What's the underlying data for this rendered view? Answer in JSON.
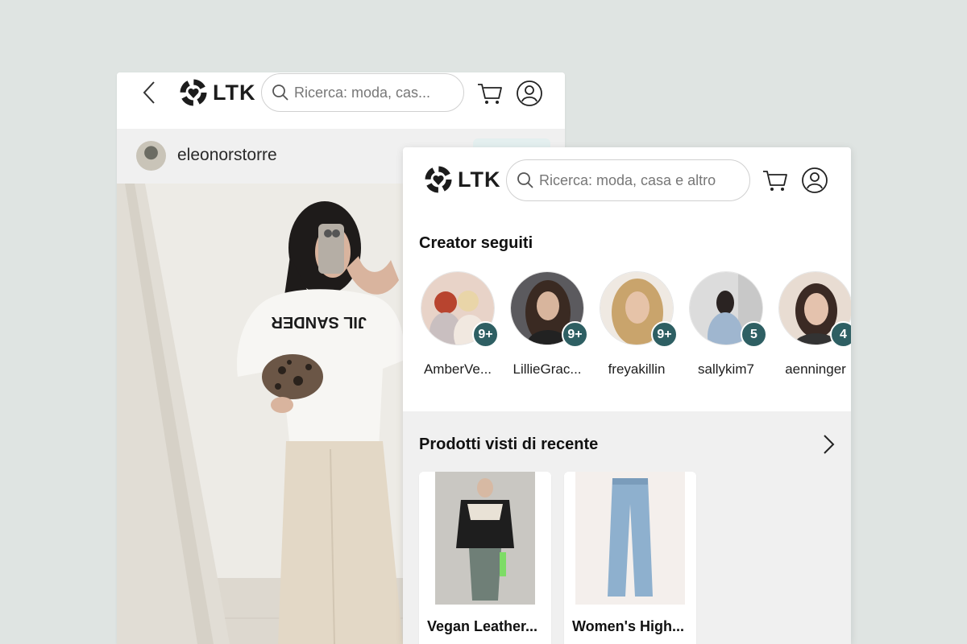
{
  "back_window": {
    "search_placeholder": "Ricerca: moda, cas...",
    "profile_name": "eleonorstorre",
    "logo_text": "LTK"
  },
  "front_window": {
    "logo_text": "LTK",
    "search_placeholder": "Ricerca: moda, casa e altro",
    "creators_title": "Creator seguiti",
    "creators": [
      {
        "name": "AmberVe...",
        "badge": "9+"
      },
      {
        "name": "LillieGrac...",
        "badge": "9+"
      },
      {
        "name": "freyakillin",
        "badge": "9+"
      },
      {
        "name": "sallykim7",
        "badge": "5"
      },
      {
        "name": "aenninger",
        "badge": "4"
      }
    ],
    "recent_title": "Prodotti visti di recente",
    "products": [
      {
        "title": "Vegan Leather..."
      },
      {
        "title": "Women's High..."
      }
    ]
  },
  "colors": {
    "background": "#dfe4e2",
    "badge": "#2e5f63",
    "section_gray": "#f0f0f0"
  },
  "icons": [
    "chevron-left-icon",
    "ltk-logo-icon",
    "search-icon",
    "cart-icon",
    "user-icon",
    "chevron-right-icon"
  ]
}
